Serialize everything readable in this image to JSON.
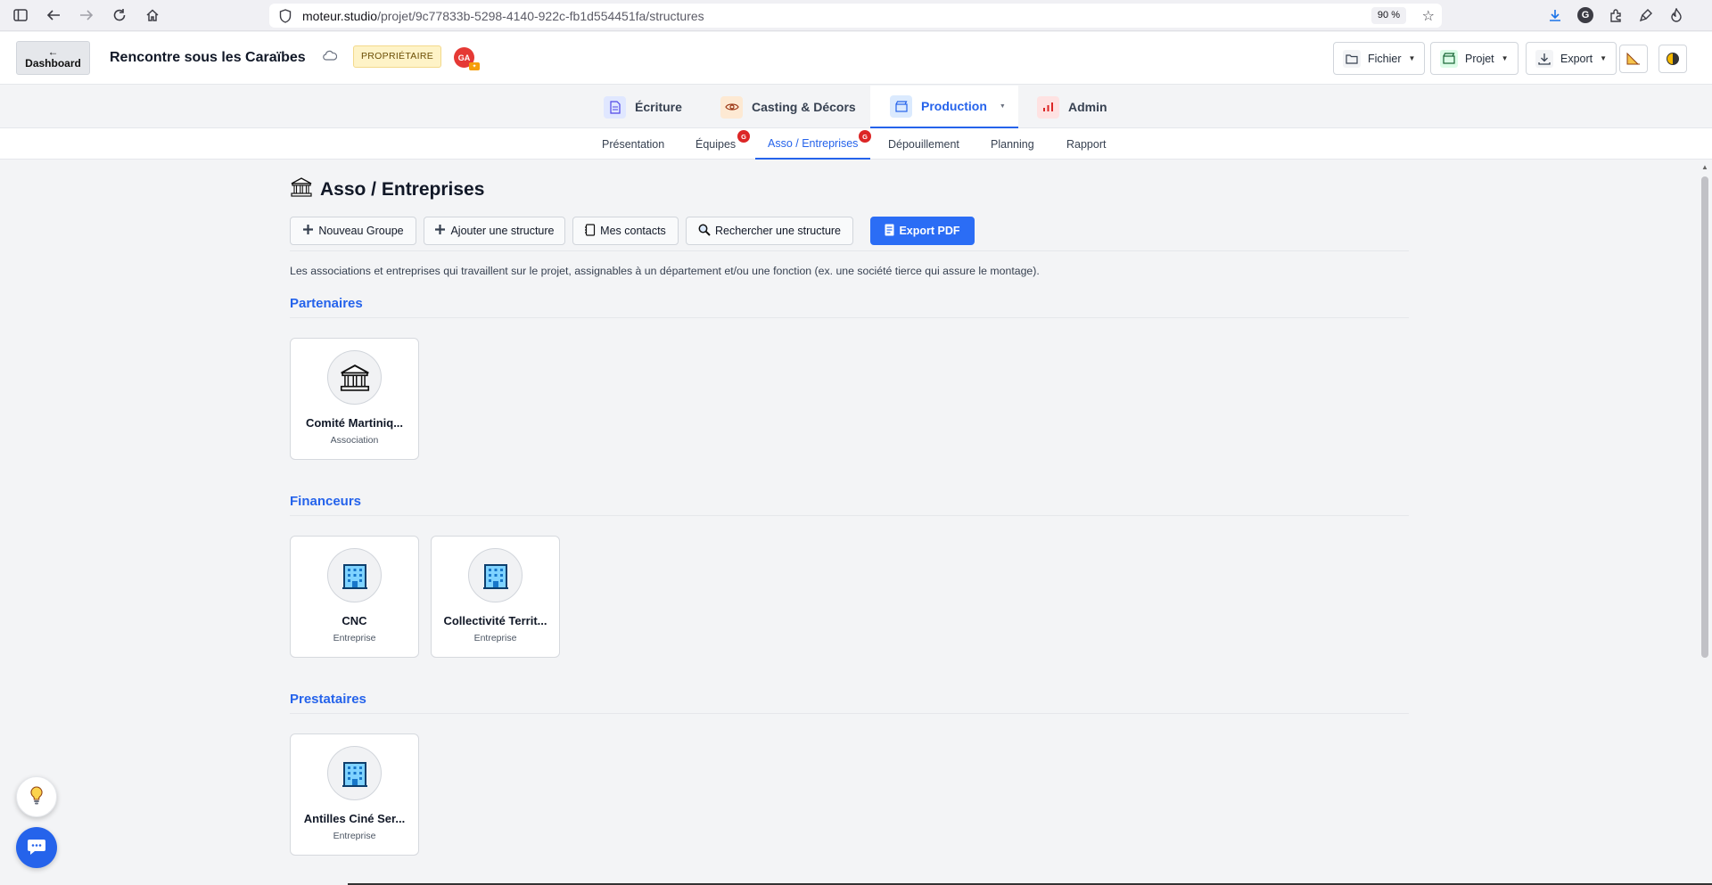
{
  "browser": {
    "url_host": "moteur.studio",
    "url_path": "/projet/9c77833b-5298-4140-922c-fb1d554451fa/structures",
    "zoom": "90 %",
    "profile_initial": "G"
  },
  "header": {
    "dashboard_arrow": "←",
    "dashboard_label": "Dashboard",
    "project_title": "Rencontre sous les Caraïbes",
    "owner_badge": "PROPRIÉTAIRE",
    "user_initials": "GA",
    "buttons": {
      "fichier": "Fichier",
      "projet": "Projet",
      "export": "Export"
    }
  },
  "main_tabs": [
    {
      "label": "Écriture"
    },
    {
      "label": "Casting & Décors"
    },
    {
      "label": "Production"
    },
    {
      "label": "Admin"
    }
  ],
  "sub_tabs": [
    {
      "label": "Présentation"
    },
    {
      "label": "Équipes",
      "badge": "G"
    },
    {
      "label": "Asso / Entreprises",
      "badge": "G"
    },
    {
      "label": "Dépouillement"
    },
    {
      "label": "Planning"
    },
    {
      "label": "Rapport"
    }
  ],
  "page": {
    "title": "Asso / Entreprises",
    "toolbar": {
      "new_group": "Nouveau Groupe",
      "add_structure": "Ajouter une structure",
      "my_contacts": "Mes contacts",
      "search_structure": "Rechercher une structure",
      "export_pdf": "Export PDF"
    },
    "description": "Les associations et entreprises qui travaillent sur le projet, assignables à un département et/ou une fonction (ex. une société tierce qui assure le montage).",
    "groups": [
      {
        "title": "Partenaires",
        "cards": [
          {
            "name": "Comité Martiniq...",
            "type": "Association",
            "icon": "bank-icon"
          }
        ]
      },
      {
        "title": "Financeurs",
        "cards": [
          {
            "name": "CNC",
            "type": "Entreprise",
            "icon": "office-building-icon"
          },
          {
            "name": "Collectivité Territ...",
            "type": "Entreprise",
            "icon": "office-building-icon"
          }
        ]
      },
      {
        "title": "Prestataires",
        "cards": [
          {
            "name": "Antilles Ciné Ser...",
            "type": "Entreprise",
            "icon": "office-building-icon"
          }
        ]
      }
    ]
  },
  "colors": {
    "accent": "#2563eb",
    "badge_red": "#dc2626",
    "owner_badge_bg": "#fef3c7"
  }
}
